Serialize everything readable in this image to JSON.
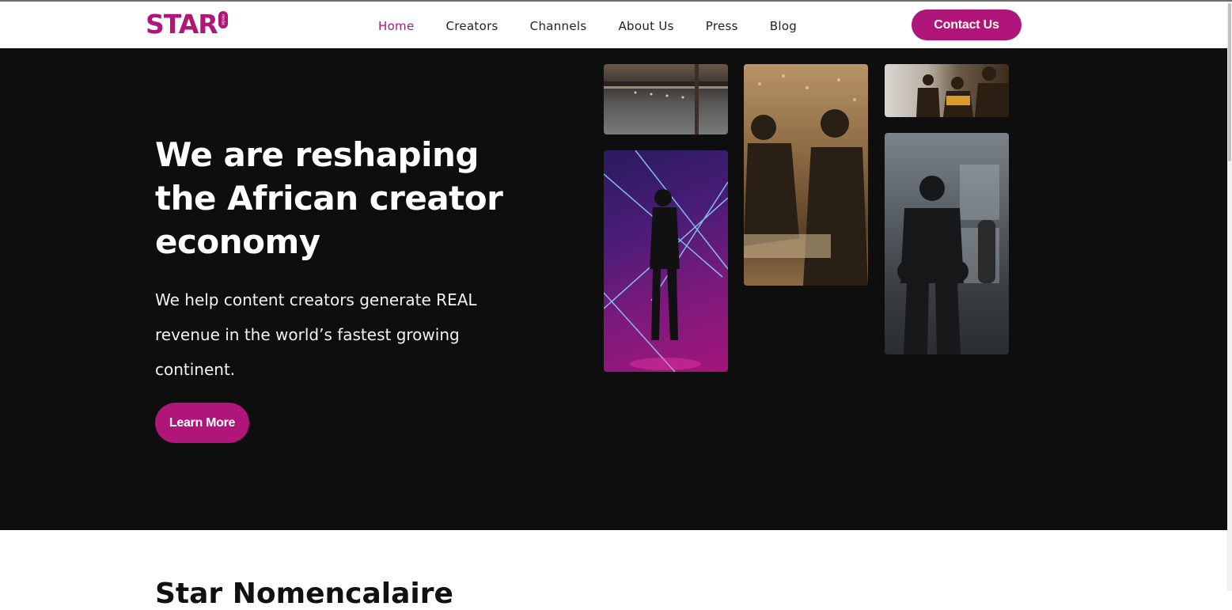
{
  "brand": {
    "logo_text": "STAR",
    "logo_badge": "media",
    "accent": "#b0157a"
  },
  "nav": {
    "items": [
      {
        "label": "Home",
        "active": true
      },
      {
        "label": "Creators"
      },
      {
        "label": "Channels"
      },
      {
        "label": "About Us"
      },
      {
        "label": "Press"
      },
      {
        "label": "Blog"
      }
    ],
    "contact_label": "Contact Us"
  },
  "hero": {
    "headline": "We are reshaping the African creator economy",
    "subtext": "We help content creators generate REAL revenue in the world’s fastest growing continent.",
    "cta_label": "Learn More",
    "background": "#0e0e0f"
  },
  "next_section": {
    "heading": "Star Nomencalaire"
  }
}
